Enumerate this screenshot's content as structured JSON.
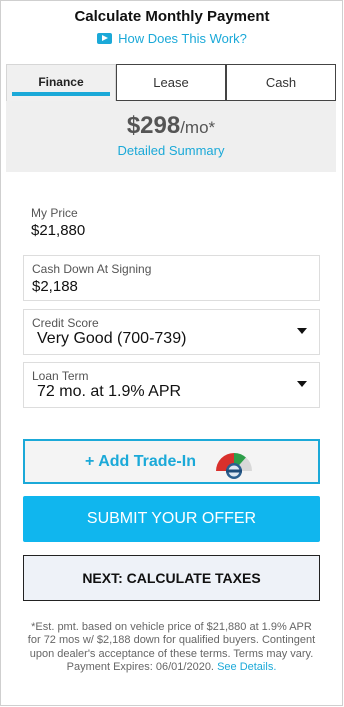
{
  "header": {
    "title": "Calculate Monthly Payment",
    "how_link": "How Does This Work?"
  },
  "tabs": [
    {
      "label": "Finance",
      "active": true
    },
    {
      "label": "Lease",
      "active": false
    },
    {
      "label": "Cash",
      "active": false
    }
  ],
  "summary": {
    "amount": "$298",
    "per": "/mo*",
    "detailed_link": "Detailed Summary"
  },
  "fields": {
    "my_price": {
      "label": "My Price",
      "value": "$21,880"
    },
    "cash_down": {
      "label": "Cash Down At Signing",
      "value": "$2,188"
    },
    "credit_score": {
      "label": "Credit Score",
      "value": "Very Good (700-739)"
    },
    "loan_term": {
      "label": "Loan Term",
      "value": "72 mo. at 1.9% APR"
    }
  },
  "buttons": {
    "trade_in": "+ Add Trade-In",
    "submit": "SUBMIT YOUR OFFER",
    "next": "NEXT: CALCULATE TAXES"
  },
  "disclaimer": {
    "text": "*Est. pmt. based on vehicle price of $21,880 at 1.9% APR for 72 mos w/ $2,188 down for qualified buyers. Contingent upon dealer's acceptance of these terms. Terms may vary. Payment Expires: 06/01/2020.",
    "link": "See Details."
  },
  "colors": {
    "accent": "#1ba9d8",
    "submit_bg": "#10b6ee",
    "next_bg": "#eef2f8"
  },
  "icons": [
    "play-icon",
    "trade-in-gauge-icon",
    "chevron-down-icon"
  ]
}
